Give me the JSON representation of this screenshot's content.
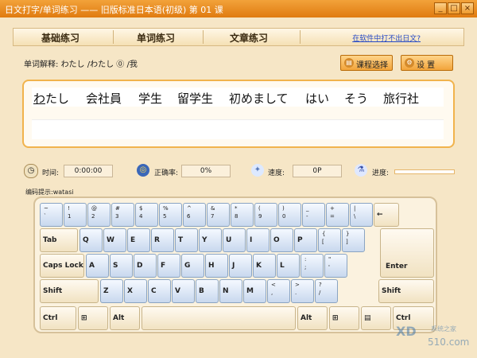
{
  "title": "日文打字/单词练习 —— 旧版标准日本语(初级) 第 01 课",
  "window_controls": {
    "minimize": "_",
    "maximize": "□",
    "close": "×"
  },
  "menu": {
    "items": [
      "基础练习",
      "单词练习",
      "文章练习"
    ],
    "link": "在软件中打不出日文?"
  },
  "definition": {
    "label": "单词解释:",
    "text": "わたし /わたし ⓪ /我"
  },
  "buttons": {
    "lesson_select": "课程选择",
    "settings": "设 置"
  },
  "words": [
    {
      "first": "わ",
      "rest": "たし"
    },
    {
      "text": "会社員"
    },
    {
      "text": "学生"
    },
    {
      "text": "留学生"
    },
    {
      "text": "初めまして"
    },
    {
      "text": "はい"
    },
    {
      "text": "そう"
    },
    {
      "text": "旅行社"
    }
  ],
  "stats": {
    "time_label": "时间:",
    "time_value": "0:00:00",
    "accuracy_label": "正确率:",
    "accuracy_value": "0%",
    "speed_label": "速度:",
    "speed_value": "0P",
    "progress_label": "进度:",
    "progress": 0
  },
  "hint": {
    "label": "编码提示:",
    "value": "watasi"
  },
  "keyboard": {
    "row1": [
      {
        "t": "~",
        "b": "`"
      },
      {
        "t": "!",
        "b": "1"
      },
      {
        "t": "@",
        "b": "2"
      },
      {
        "t": "#",
        "b": "3"
      },
      {
        "t": "$",
        "b": "4"
      },
      {
        "t": "%",
        "b": "5"
      },
      {
        "t": "^",
        "b": "6"
      },
      {
        "t": "&",
        "b": "7"
      },
      {
        "t": "*",
        "b": "8"
      },
      {
        "t": "(",
        "b": "9"
      },
      {
        "t": ")",
        "b": "0"
      },
      {
        "t": "_",
        "b": "-"
      },
      {
        "t": "+",
        "b": "="
      },
      {
        "t": "|",
        "b": "\\"
      }
    ],
    "backspace": "←",
    "tab": "Tab",
    "row2": [
      "Q",
      "W",
      "E",
      "R",
      "T",
      "Y",
      "U",
      "I",
      "O",
      "P"
    ],
    "row2b": [
      {
        "t": "{",
        "b": "["
      },
      {
        "t": "}",
        "b": "]"
      }
    ],
    "caps": "Caps Lock",
    "row3": [
      "A",
      "S",
      "D",
      "F",
      "G",
      "H",
      "J",
      "K",
      "L"
    ],
    "row3b": [
      {
        "t": ":",
        "b": ";"
      },
      {
        "t": "\"",
        "b": "'"
      }
    ],
    "enter": "Enter",
    "shift_left": "Shift",
    "row4": [
      "Z",
      "X",
      "C",
      "V",
      "B",
      "N",
      "M"
    ],
    "row4b": [
      {
        "t": "<",
        "b": ","
      },
      {
        "t": ">",
        "b": "."
      },
      {
        "t": "?",
        "b": "/"
      }
    ],
    "shift_right": "Shift",
    "ctrl": "Ctrl",
    "alt": "Alt",
    "win": "⊞",
    "menu": "▤"
  },
  "watermark": {
    "big": "XD",
    "small": "系统之家",
    "url": "510.com"
  }
}
